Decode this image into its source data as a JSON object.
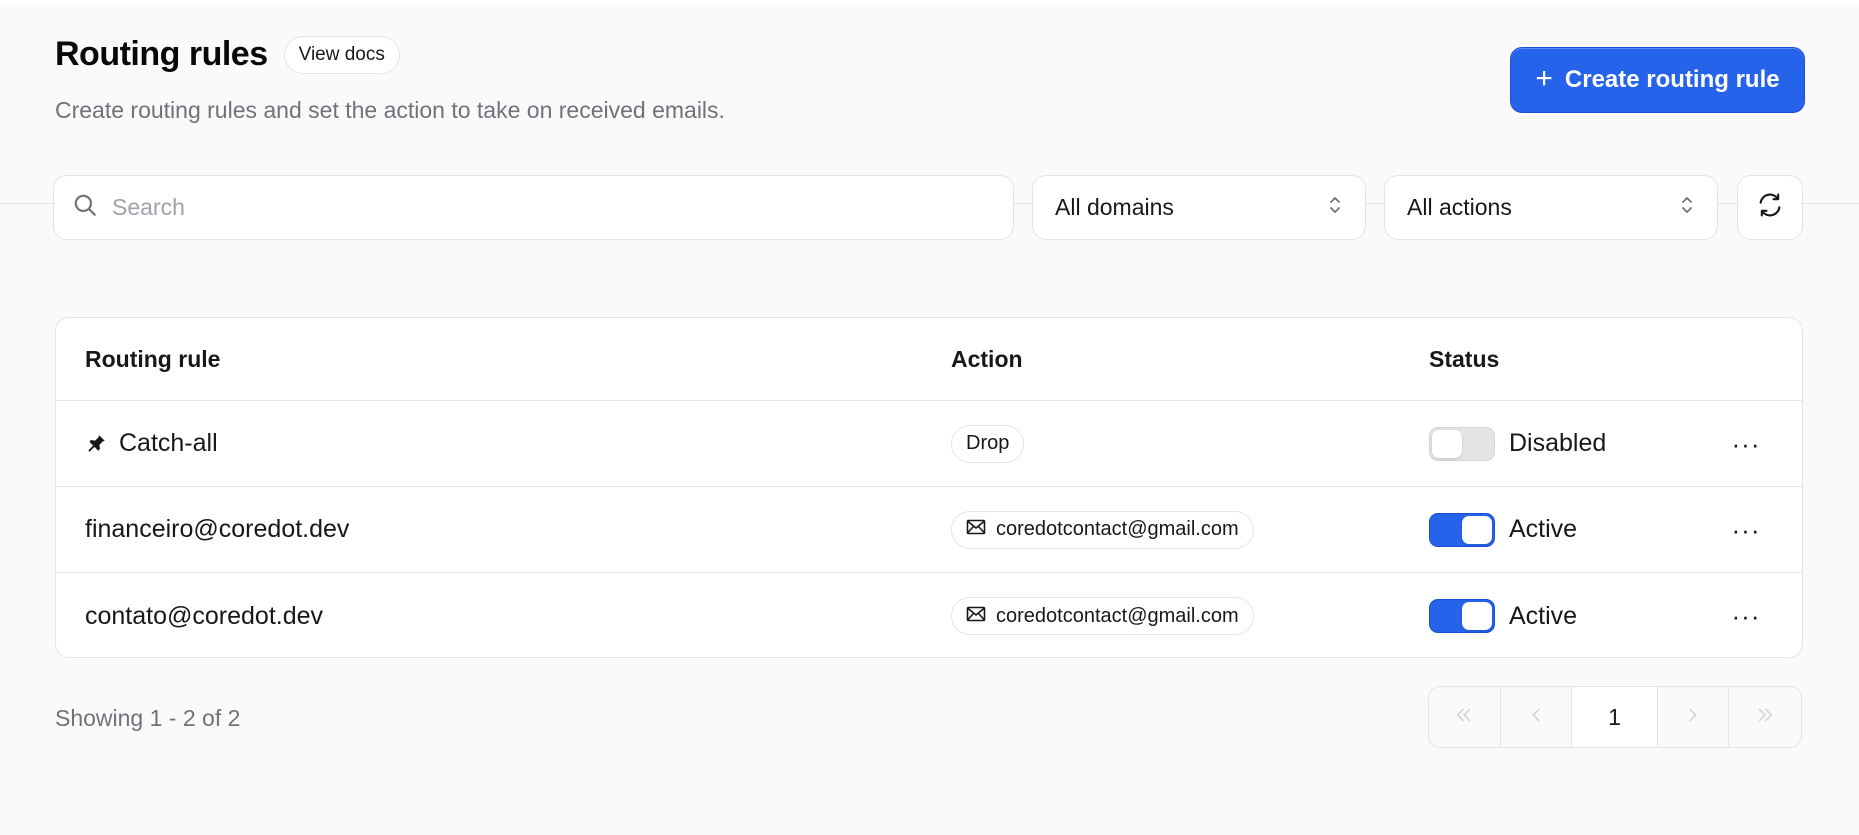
{
  "header": {
    "title": "Routing rules",
    "docs_label": "View docs",
    "subtitle": "Create routing rules and set the action to take on received emails.",
    "create_label": "Create routing rule"
  },
  "filters": {
    "search_placeholder": "Search",
    "domain_select": "All domains",
    "action_select": "All actions"
  },
  "table": {
    "columns": {
      "rule": "Routing rule",
      "action": "Action",
      "status": "Status"
    },
    "rows": [
      {
        "rule": "Catch-all",
        "pinned": true,
        "action": "Drop",
        "action_icon": "",
        "status": "Disabled",
        "enabled": false
      },
      {
        "rule": "financeiro@coredot.dev",
        "pinned": false,
        "action": "coredotcontact@gmail.com",
        "action_icon": "mail-icon",
        "status": "Active",
        "enabled": true
      },
      {
        "rule": "contato@coredot.dev",
        "pinned": false,
        "action": "coredotcontact@gmail.com",
        "action_icon": "mail-icon",
        "status": "Active",
        "enabled": true
      }
    ],
    "more_label": "···"
  },
  "footer": {
    "showing": "Showing 1 - 2 of 2",
    "current_page": "1"
  },
  "colors": {
    "accent": "#2563eb",
    "toggle_off": "#e4e4e7"
  }
}
